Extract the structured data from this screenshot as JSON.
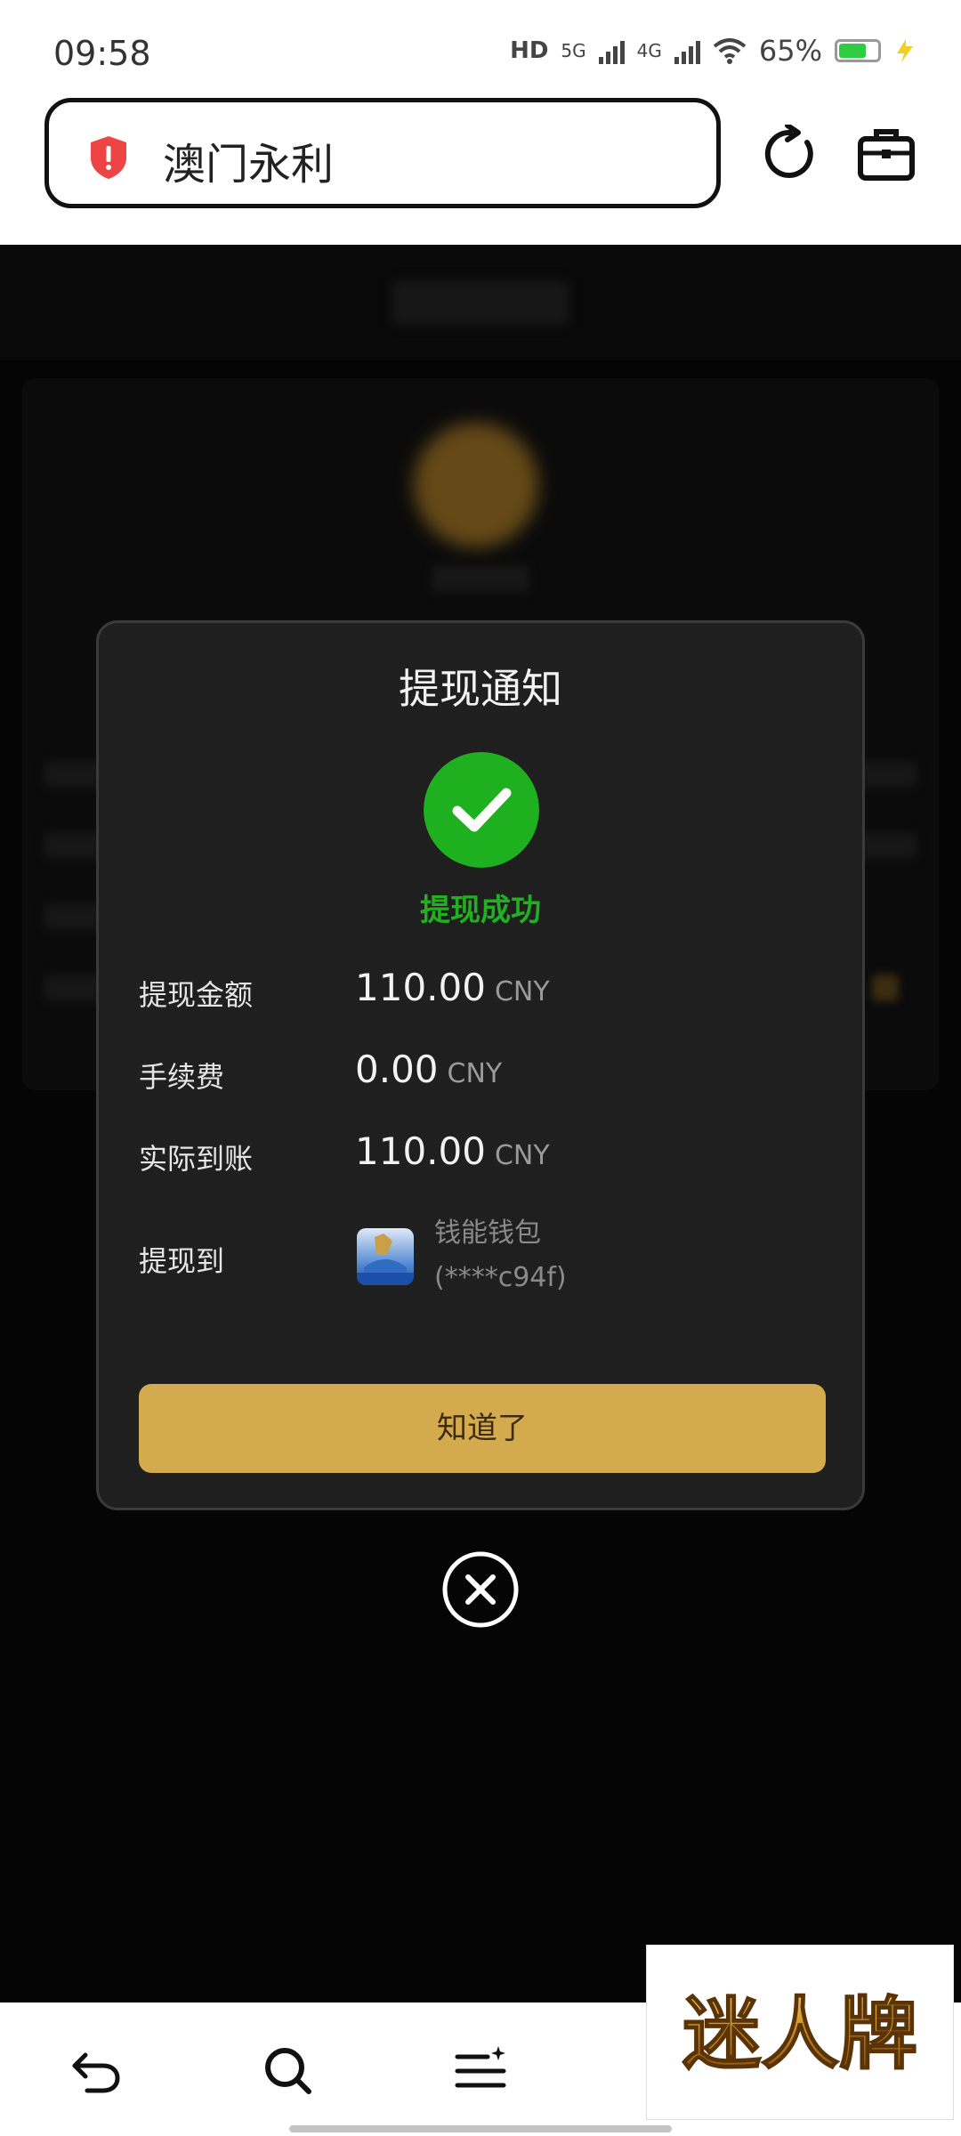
{
  "status_bar": {
    "time": "09:58",
    "network_hd": "HD",
    "network_5g": "5G",
    "network_4g": "4G",
    "battery_pct": "65%"
  },
  "browser": {
    "address_text": "澳门永利",
    "security_icon": "shield-alert-icon",
    "reload_icon": "reload-icon",
    "tools_icon": "toolbox-icon"
  },
  "modal": {
    "title": "提现通知",
    "status_icon": "check-circle-icon",
    "status_text": "提现成功",
    "status_color": "#22b022",
    "rows": [
      {
        "label": "提现金额",
        "value": "110.00",
        "unit": "CNY"
      },
      {
        "label": "手续费",
        "value": "0.00",
        "unit": "CNY"
      },
      {
        "label": "实际到账",
        "value": "110.00",
        "unit": "CNY"
      }
    ],
    "destination_label": "提现到",
    "destination_name": "钱能钱包",
    "destination_account": "(****c94f)",
    "ok_button": "知道了",
    "ok_button_color": "#d4aa4e"
  },
  "close_icon": "close-circle-icon",
  "bottom_nav": {
    "back_icon": "back-arrow-icon",
    "search_icon": "search-icon",
    "menu_icon": "menu-icon"
  },
  "watermark": {
    "text": "迷人牌"
  }
}
